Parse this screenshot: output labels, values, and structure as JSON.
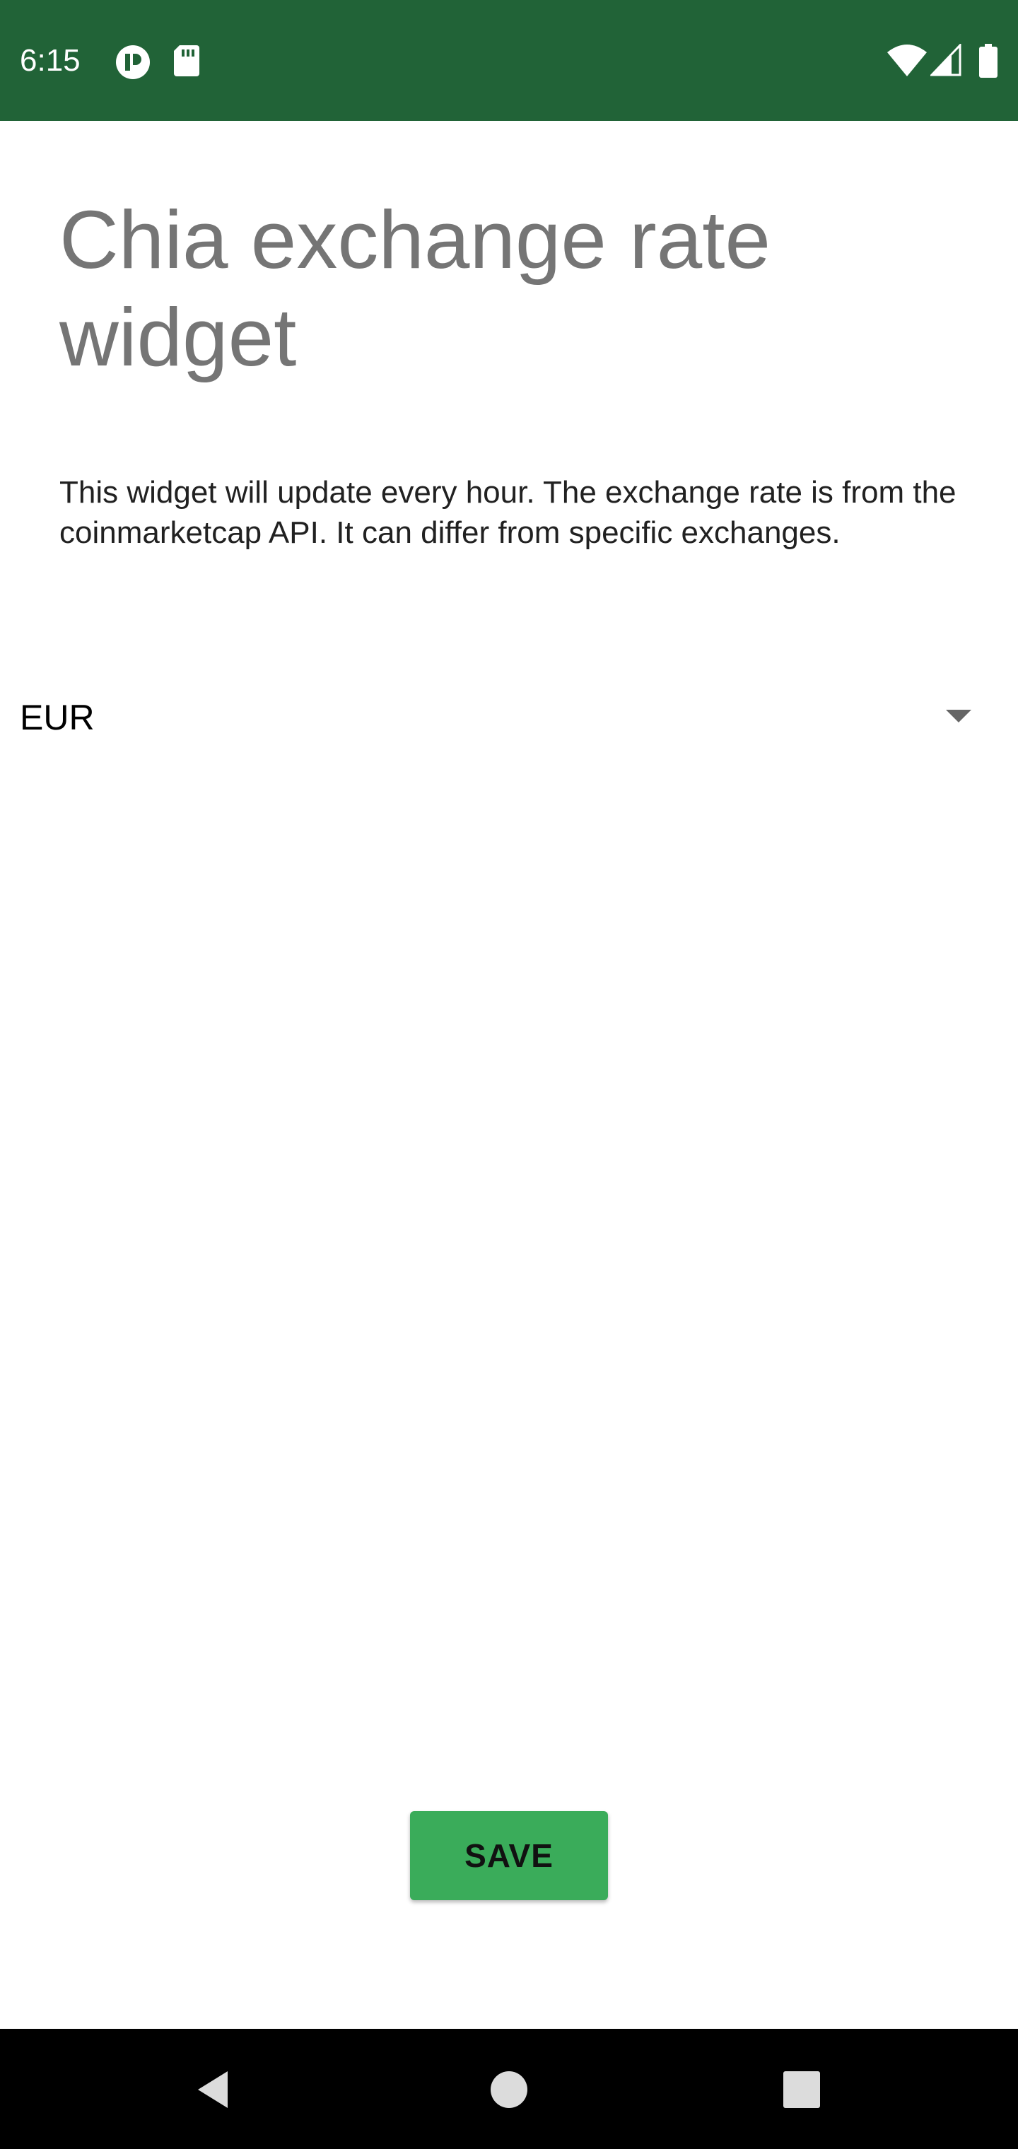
{
  "status_bar": {
    "time": "6:15",
    "background_color": "#216337",
    "left_icons": [
      "app-notification-icon",
      "sd-card-icon"
    ],
    "right_icons": [
      "wifi-icon",
      "cell-signal-icon",
      "battery-icon"
    ]
  },
  "main": {
    "title": "Chia exchange rate widget",
    "description": "This widget will update every hour. The exchange rate is from the coinmarketcap API. It can differ from specific exchanges.",
    "currency": {
      "selected": "EUR",
      "icon": "dropdown-arrow-icon"
    },
    "save_label": "SAVE",
    "accent_color": "#3aac5a"
  },
  "nav_bar": {
    "buttons": [
      "back-icon",
      "home-icon",
      "recents-icon"
    ]
  }
}
